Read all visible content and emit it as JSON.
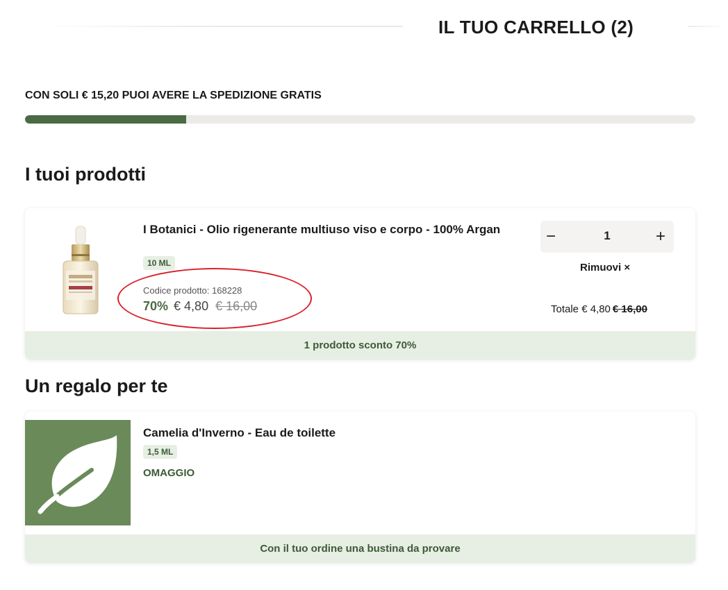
{
  "header": {
    "title": "IL TUO CARRELLO (2)"
  },
  "shipping": {
    "message": "CON SOLI € 15,20 PUOI AVERE LA SPEDIZIONE GRATIS",
    "progress_percent": 24
  },
  "products_section": {
    "title": "I tuoi prodotti"
  },
  "product": {
    "name": "I Botanici - Olio rigenerante multiuso viso e corpo - 100% Argan",
    "size": "10 ML",
    "code": "Codice prodotto: 168228",
    "discount": "70%",
    "price": "€ 4,80",
    "old_price": "€ 16,00",
    "quantity": "1",
    "minus_symbol": "−",
    "plus_symbol": "+",
    "remove_label": "Rimuovi ×",
    "total_label": "Totale € 4,80",
    "total_old": "€ 16,00",
    "footer": "1 prodotto sconto 70%",
    "image_icon": "serum-bottle-image"
  },
  "gift_section": {
    "title": "Un regalo per te"
  },
  "gift": {
    "name": "Camelia d'Inverno - Eau de toilette",
    "size": "1,5 ML",
    "label": "OMAGGIO",
    "footer": "Con il tuo ordine una bustina da provare",
    "image_icon": "leaf-icon"
  },
  "colors": {
    "accent_green": "#4a6a44",
    "leaf_bg": "#6a8a5a",
    "footer_bg": "#e7eee4",
    "annotation_red": "#d9202b"
  }
}
